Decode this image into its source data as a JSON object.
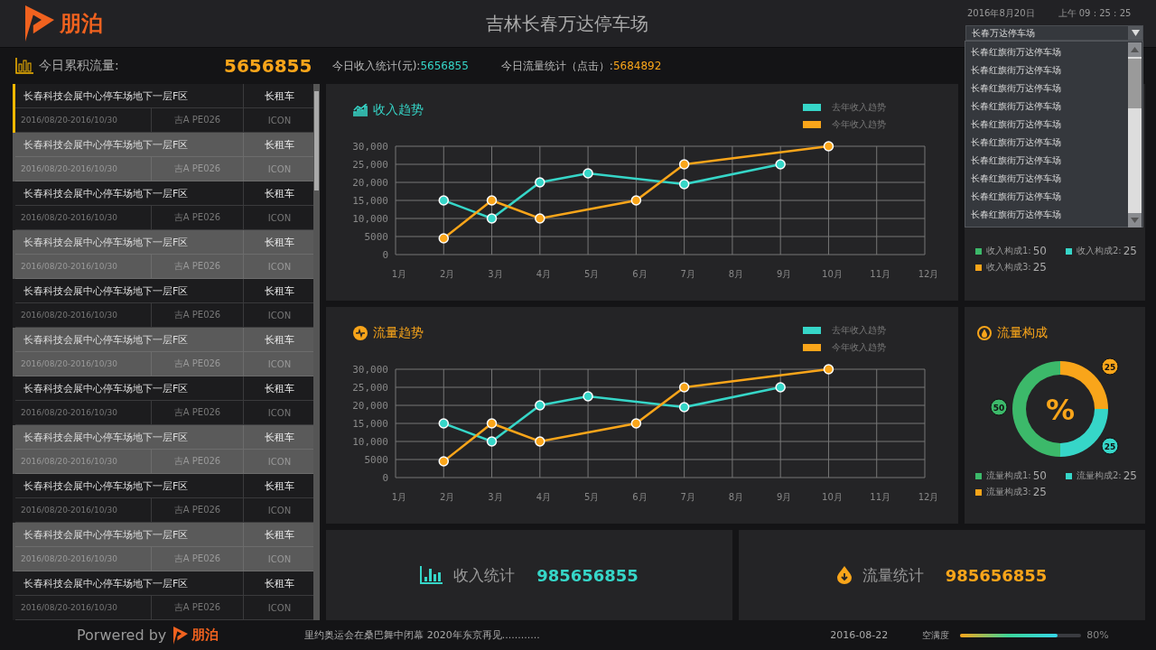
{
  "header": {
    "brand": "朋泊",
    "title": "吉林长春万达停车场",
    "date": "2016年8月20日",
    "time": "上午  09 : 25 : 25",
    "dropdown": {
      "value": "长春万达停车场",
      "expanded": true,
      "options": [
        "长春红旗街万达停车场",
        "长春红旗街万达停车场",
        "长春红旗街万达停车场",
        "长春红旗街万达停车场",
        "长春红旗街万达停车场",
        "长春红旗街万达停车场",
        "长春红旗街万达停车场",
        "长春红旗街万达停车场",
        "长春红旗街万达停车场",
        "长春红旗街万达停车场"
      ]
    }
  },
  "stats_bar": {
    "label": "今日累积流量:",
    "value": "5656855",
    "items": [
      {
        "label": "今日收入统计(元):",
        "value": "5656855",
        "kind": "income"
      },
      {
        "label": "今日流量统计（点击）:",
        "value": "5684892",
        "kind": "traffic"
      }
    ]
  },
  "parking_list": [
    {
      "name": "长春科技会展中心停车场地下一层F区",
      "type": "长租车",
      "period": "2016/08/20-2016/10/30",
      "plate": "吉A PE026",
      "tag": "ICON",
      "selected": true
    },
    {
      "name": "长春科技会展中心停车场地下一层F区",
      "type": "长租车",
      "period": "2016/08/20-2016/10/30",
      "plate": "吉A PE026",
      "tag": "ICON",
      "selected": false
    },
    {
      "name": "长春科技会展中心停车场地下一层F区",
      "type": "长租车",
      "period": "2016/08/20-2016/10/30",
      "plate": "吉A PE026",
      "tag": "ICON",
      "selected": false
    },
    {
      "name": "长春科技会展中心停车场地下一层F区",
      "type": "长租车",
      "period": "2016/08/20-2016/10/30",
      "plate": "吉A PE026",
      "tag": "ICON",
      "selected": false
    },
    {
      "name": "长春科技会展中心停车场地下一层F区",
      "type": "长租车",
      "period": "2016/08/20-2016/10/30",
      "plate": "吉A PE026",
      "tag": "ICON",
      "selected": false
    },
    {
      "name": "长春科技会展中心停车场地下一层F区",
      "type": "长租车",
      "period": "2016/08/20-2016/10/30",
      "plate": "吉A PE026",
      "tag": "ICON",
      "selected": false
    },
    {
      "name": "长春科技会展中心停车场地下一层F区",
      "type": "长租车",
      "period": "2016/08/20-2016/10/30",
      "plate": "吉A PE026",
      "tag": "ICON",
      "selected": false
    },
    {
      "name": "长春科技会展中心停车场地下一层F区",
      "type": "长租车",
      "period": "2016/08/20-2016/10/30",
      "plate": "吉A PE026",
      "tag": "ICON",
      "selected": false
    },
    {
      "name": "长春科技会展中心停车场地下一层F区",
      "type": "长租车",
      "period": "2016/08/20-2016/10/30",
      "plate": "吉A PE026",
      "tag": "ICON",
      "selected": false
    },
    {
      "name": "长春科技会展中心停车场地下一层F区",
      "type": "长租车",
      "period": "2016/08/20-2016/10/30",
      "plate": "吉A PE026",
      "tag": "ICON",
      "selected": false
    },
    {
      "name": "长春科技会展中心停车场地下一层F区",
      "type": "长租车",
      "period": "2016/08/20-2016/10/30",
      "plate": "吉A PE026",
      "tag": "ICON",
      "selected": false
    }
  ],
  "trend_panels": [
    {
      "title": "收入趋势",
      "kind": "income",
      "chart_data": {
        "type": "line",
        "grid": true,
        "categories": [
          "1月",
          "2月",
          "3月",
          "4月",
          "5月",
          "6月",
          "7月",
          "8月",
          "9月",
          "10月",
          "11月",
          "12月"
        ],
        "ylim": [
          0,
          30000
        ],
        "yticks": [
          {
            "value": 0,
            "label": "0"
          },
          {
            "value": 5000,
            "label": "5000"
          },
          {
            "value": 10000,
            "label": "10,000"
          },
          {
            "value": 15000,
            "label": "15,000"
          },
          {
            "value": 20000,
            "label": "20,000"
          },
          {
            "value": 25000,
            "label": "25,000"
          },
          {
            "value": 30000,
            "label": "30,000"
          }
        ],
        "series": [
          {
            "name": "去年收入趋势",
            "color": "#36d6c8",
            "marker": "circle",
            "values": [
              null,
              15000,
              10000,
              20000,
              22500,
              null,
              19500,
              null,
              25000,
              null,
              null,
              null
            ]
          },
          {
            "name": "今年收入趋势",
            "color": "#f9a51a",
            "marker": "circle",
            "values": [
              null,
              4500,
              15000,
              10000,
              null,
              15000,
              25000,
              null,
              null,
              30000,
              null,
              null
            ]
          }
        ]
      }
    },
    {
      "title": "流量趋势",
      "kind": "traffic",
      "chart_data": {
        "type": "line",
        "grid": true,
        "categories": [
          "1月",
          "2月",
          "3月",
          "4月",
          "5月",
          "6月",
          "7月",
          "8月",
          "9月",
          "10月",
          "11月",
          "12月"
        ],
        "ylim": [
          0,
          30000
        ],
        "yticks": [
          {
            "value": 0,
            "label": "0"
          },
          {
            "value": 5000,
            "label": "5000"
          },
          {
            "value": 10000,
            "label": "10,000"
          },
          {
            "value": 15000,
            "label": "15,000"
          },
          {
            "value": 20000,
            "label": "20,000"
          },
          {
            "value": 25000,
            "label": "25,000"
          },
          {
            "value": 30000,
            "label": "30,000"
          }
        ],
        "series": [
          {
            "name": "去年收入趋势",
            "color": "#36d6c8",
            "marker": "circle",
            "values": [
              null,
              15000,
              10000,
              20000,
              22500,
              null,
              19500,
              null,
              25000,
              null,
              null,
              null
            ]
          },
          {
            "name": "今年收入趋势",
            "color": "#f9a51a",
            "marker": "circle",
            "values": [
              null,
              4500,
              15000,
              10000,
              null,
              15000,
              25000,
              null,
              null,
              30000,
              null,
              null
            ]
          }
        ]
      }
    }
  ],
  "income_composition": {
    "legend": [
      {
        "label": "收入构成1:",
        "value": "50",
        "color": "#3cb96a"
      },
      {
        "label": "收入构成2:",
        "value": "25",
        "color": "#36d6c8"
      },
      {
        "label": "收入构成3:",
        "value": "25",
        "color": "#f9a51a"
      }
    ]
  },
  "traffic_composition": {
    "title": "流量构成",
    "center_label": "%",
    "chart_data": {
      "type": "donut",
      "values": [
        50,
        25,
        25
      ],
      "colors": [
        "#3cb96a",
        "#36d6c8",
        "#f9a51a"
      ],
      "data_labels": true
    },
    "legend": [
      {
        "label": "流量构成1:",
        "value": "50",
        "color": "#3cb96a"
      },
      {
        "label": "流量构成2:",
        "value": "25",
        "color": "#36d6c8"
      },
      {
        "label": "流量构成3:",
        "value": "25",
        "color": "#f9a51a"
      }
    ]
  },
  "summary_cards": [
    {
      "label": "收入统计",
      "value": "985656855",
      "kind": "income"
    },
    {
      "label": "流量统计",
      "value": "985656855",
      "kind": "traffic"
    }
  ],
  "footer": {
    "powered_by": "Porwered by",
    "brand": "朋泊",
    "news": "里约奥运会在桑巴舞中闭幕 2020年东京再见............",
    "date": "2016-08-22",
    "meter": {
      "label": "空满度",
      "level": 0.8,
      "reading": "80%"
    }
  }
}
